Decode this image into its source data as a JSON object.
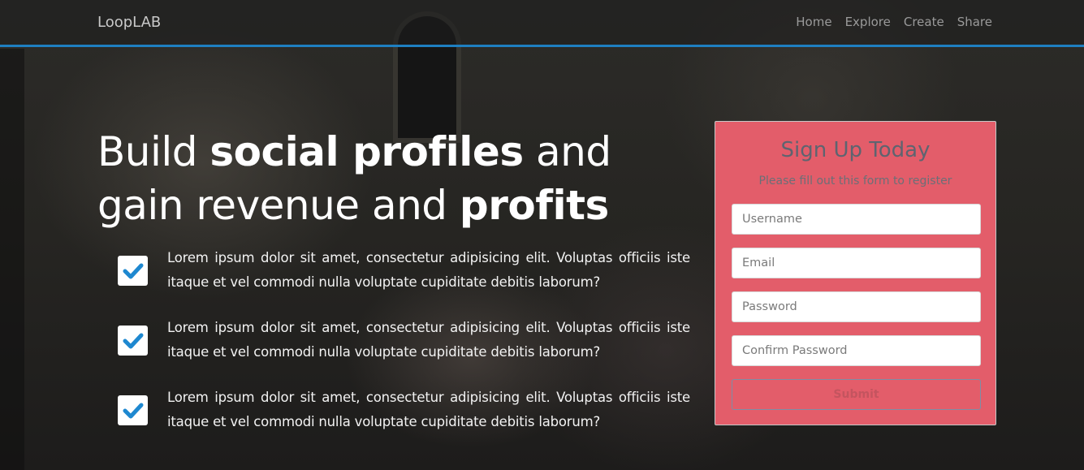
{
  "navbar": {
    "brand": "LoopLAB",
    "links": [
      "Home",
      "Explore",
      "Create",
      "Share"
    ],
    "accent_color": "#1e7fc1"
  },
  "hero": {
    "title_parts": [
      "Build ",
      "social profiles",
      " and gain revenue and ",
      "profits"
    ],
    "features": [
      "Lorem ipsum dolor sit amet, consectetur adipisicing elit. Voluptas officiis iste itaque et vel commodi nulla voluptate cupiditate debitis laborum?",
      "Lorem ipsum dolor sit amet, consectetur adipisicing elit. Voluptas officiis iste itaque et vel commodi nulla voluptate cupiditate debitis laborum?",
      "Lorem ipsum dolor sit amet, consectetur adipisicing elit. Voluptas officiis iste itaque et vel commodi nulla voluptate cupiditate debitis laborum?"
    ],
    "feature_icon": "check-icon",
    "check_color": "#1e88d0"
  },
  "signup": {
    "title": "Sign Up Today",
    "subtitle": "Please fill out this form to register",
    "fields": {
      "username_placeholder": "Username",
      "email_placeholder": "Email",
      "password_placeholder": "Password",
      "confirm_placeholder": "Confirm Password"
    },
    "submit_label": "Submit",
    "card_color": "#e35d6a"
  }
}
